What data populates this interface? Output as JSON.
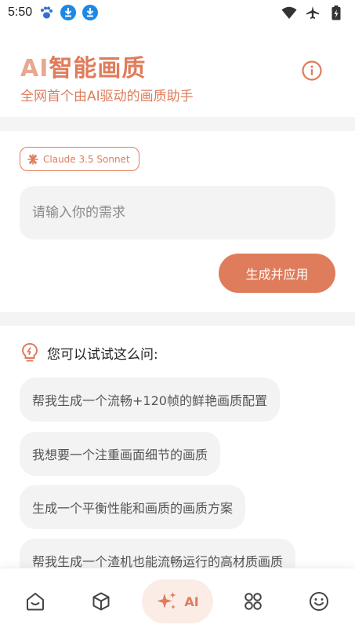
{
  "status_bar": {
    "time": "5:50"
  },
  "header": {
    "title_ai": "AI",
    "title_rest": "智能画质",
    "subtitle": "全网首个由AI驱动的画质助手"
  },
  "model_badge": {
    "label": "Claude 3.5 Sonnet"
  },
  "request": {
    "placeholder": "请输入你的需求",
    "value": "",
    "button_label": "生成并应用"
  },
  "suggestions": {
    "title": "您可以试试这么问:",
    "items": [
      "帮我生成一个流畅+120帧的鲜艳画质配置",
      "我想要一个注重画面细节的画质",
      "生成一个平衡性能和画质的画质方案",
      "帮我生成一个渣机也能流畅运行的高材质画质"
    ]
  },
  "bottom_nav": {
    "ai_label": "AI",
    "active": "ai"
  },
  "colors": {
    "accent": "#df7c5b",
    "accent_light": "#fbece6",
    "surface": "#f3f3f3",
    "status_blue": "#1e88e5"
  }
}
